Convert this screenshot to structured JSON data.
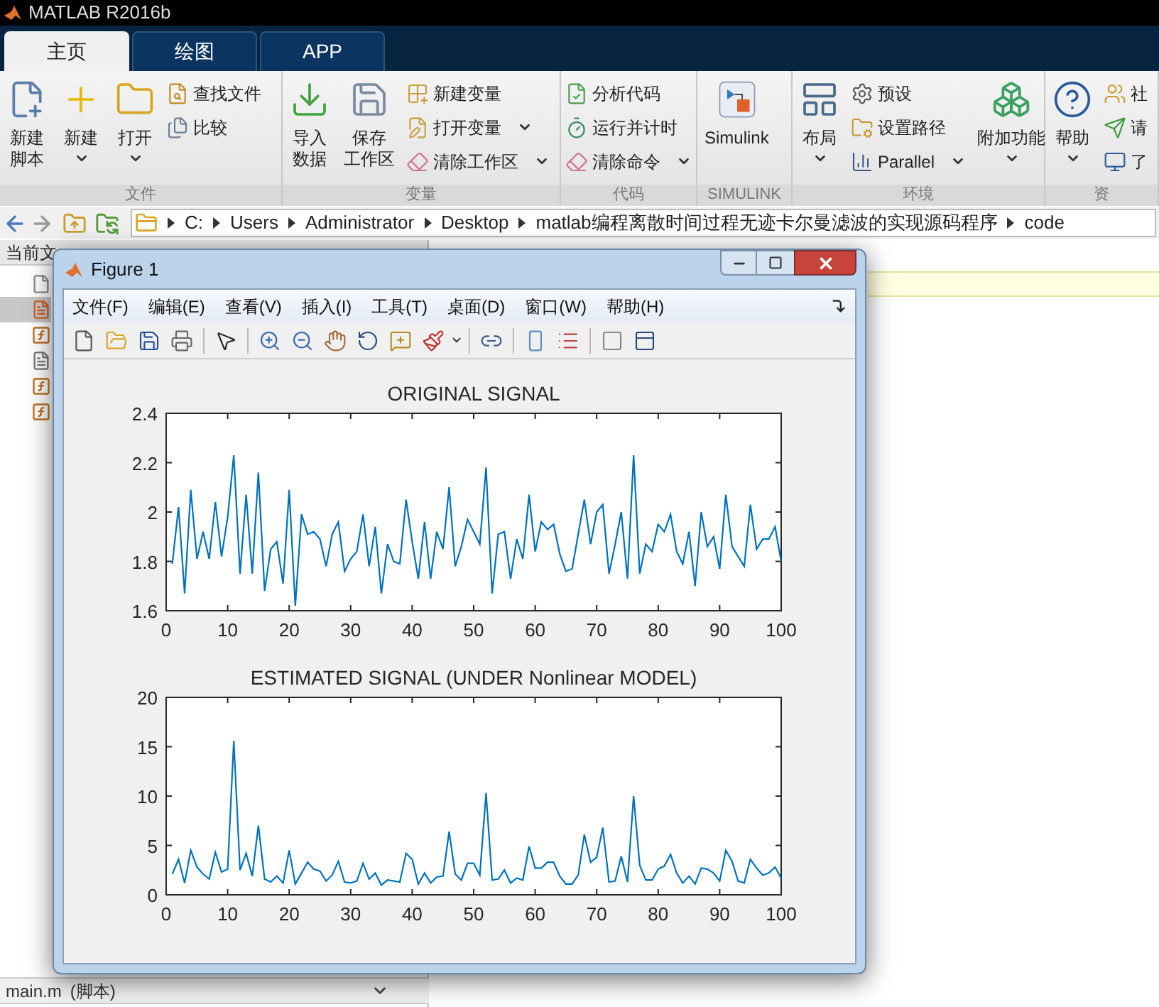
{
  "window": {
    "title": "MATLAB R2016b"
  },
  "tabs": [
    {
      "label": "主页",
      "selected": true
    },
    {
      "label": "绘图",
      "selected": false
    },
    {
      "label": "APP",
      "selected": false
    }
  ],
  "ribbon": {
    "groups": [
      {
        "label": "文件",
        "items": [
          {
            "kind": "large",
            "lines": [
              "新建",
              "脚本"
            ],
            "dropdown": false
          },
          {
            "kind": "large",
            "lines": [
              "新建"
            ],
            "dropdown": true
          },
          {
            "kind": "large",
            "lines": [
              "打开"
            ],
            "dropdown": true
          },
          {
            "kind": "stack",
            "items": [
              {
                "label": "查找文件",
                "dropdown": false
              },
              {
                "label": "比较",
                "dropdown": false
              }
            ]
          }
        ]
      },
      {
        "label": "变量",
        "items": [
          {
            "kind": "large",
            "lines": [
              "导入",
              "数据"
            ],
            "dropdown": false
          },
          {
            "kind": "large",
            "lines": [
              "保存",
              "工作区"
            ],
            "dropdown": false
          },
          {
            "kind": "stack",
            "items": [
              {
                "label": "新建变量",
                "dropdown": false
              },
              {
                "label": "打开变量",
                "dropdown": true
              },
              {
                "label": "清除工作区",
                "dropdown": true
              }
            ]
          }
        ]
      },
      {
        "label": "代码",
        "items": [
          {
            "kind": "stack",
            "items": [
              {
                "label": "分析代码",
                "dropdown": false
              },
              {
                "label": "运行并计时",
                "dropdown": false
              },
              {
                "label": "清除命令",
                "dropdown": true
              }
            ]
          }
        ]
      },
      {
        "label": "SIMULINK",
        "items": [
          {
            "kind": "large",
            "lines": [
              "Simulink"
            ],
            "dropdown": false
          }
        ]
      },
      {
        "label": "环境",
        "items": [
          {
            "kind": "large",
            "lines": [
              "布局"
            ],
            "dropdown": true
          },
          {
            "kind": "stack",
            "items": [
              {
                "label": "预设",
                "dropdown": false
              },
              {
                "label": "设置路径",
                "dropdown": false
              },
              {
                "label": "Parallel",
                "dropdown": true
              }
            ]
          },
          {
            "kind": "large",
            "lines": [
              "附加功能"
            ],
            "dropdown": true
          }
        ]
      },
      {
        "label": "资",
        "items": [
          {
            "kind": "large",
            "lines": [
              "帮助"
            ],
            "dropdown": true
          },
          {
            "kind": "stack",
            "items": [
              {
                "label": "社",
                "dropdown": false
              },
              {
                "label": "请",
                "dropdown": false
              },
              {
                "label": "了",
                "dropdown": false
              }
            ]
          }
        ]
      }
    ]
  },
  "address_bar": {
    "path": [
      "C:",
      "Users",
      "Administrator",
      "Desktop",
      "matlab编程离散时间过程无迹卡尔曼滤波的实现源码程序",
      "code"
    ]
  },
  "current_folder": {
    "title": "当前文",
    "rows": [
      {
        "kind": "blank",
        "selected": false
      },
      {
        "kind": "matlab",
        "selected": true
      },
      {
        "kind": "function",
        "selected": false
      },
      {
        "kind": "doc",
        "selected": false
      },
      {
        "kind": "function",
        "selected": false
      },
      {
        "kind": "function",
        "selected": false
      }
    ]
  },
  "details": {
    "file": "main.m",
    "type": "(脚本)"
  },
  "figure": {
    "title": "Figure 1",
    "menu": [
      "文件(F)",
      "编辑(E)",
      "查看(V)",
      "插入(I)",
      "工具(T)",
      "桌面(D)",
      "窗口(W)",
      "帮助(H)"
    ],
    "plots": [
      {
        "chart_data": {
          "type": "line",
          "title": "ORIGINAL SIGNAL",
          "x": [
            1,
            2,
            3,
            4,
            5,
            6,
            7,
            8,
            9,
            10,
            11,
            12,
            13,
            14,
            15,
            16,
            17,
            18,
            19,
            20,
            21,
            22,
            23,
            24,
            25,
            26,
            27,
            28,
            29,
            30,
            31,
            32,
            33,
            34,
            35,
            36,
            37,
            38,
            39,
            40,
            41,
            42,
            43,
            44,
            45,
            46,
            47,
            48,
            49,
            50,
            51,
            52,
            53,
            54,
            55,
            56,
            57,
            58,
            59,
            60,
            61,
            62,
            63,
            64,
            65,
            66,
            67,
            68,
            69,
            70,
            71,
            72,
            73,
            74,
            75,
            76,
            77,
            78,
            79,
            80,
            81,
            82,
            83,
            84,
            85,
            86,
            87,
            88,
            89,
            90,
            91,
            92,
            93,
            94,
            95,
            96,
            97,
            98,
            99,
            100
          ],
          "xlim": [
            0,
            100
          ],
          "ylim": [
            1.6,
            2.4
          ],
          "xticks": [
            {
              "value": 0,
              "label": "0"
            },
            {
              "value": 10,
              "label": "10"
            },
            {
              "value": 20,
              "label": "20"
            },
            {
              "value": 30,
              "label": "30"
            },
            {
              "value": 40,
              "label": "40"
            },
            {
              "value": 50,
              "label": "50"
            },
            {
              "value": 60,
              "label": "60"
            },
            {
              "value": 70,
              "label": "70"
            },
            {
              "value": 80,
              "label": "80"
            },
            {
              "value": 90,
              "label": "90"
            },
            {
              "value": 100,
              "label": "100"
            }
          ],
          "yticks": [
            {
              "value": 1.6,
              "label": "1.6"
            },
            {
              "value": 1.8,
              "label": "1.8"
            },
            {
              "value": 2,
              "label": "2"
            },
            {
              "value": 2.2,
              "label": "2.2"
            },
            {
              "value": 2.4,
              "label": "2.4"
            }
          ],
          "series": [
            {
              "color": "#0072bd",
              "values": [
                1.79,
                2.02,
                1.67,
                2.09,
                1.81,
                1.92,
                1.81,
                2.04,
                1.82,
                1.98,
                2.23,
                1.75,
                2.07,
                1.75,
                2.16,
                1.68,
                1.85,
                1.88,
                1.71,
                2.09,
                1.62,
                1.99,
                1.91,
                1.92,
                1.89,
                1.78,
                1.91,
                1.96,
                1.76,
                1.81,
                1.84,
                1.99,
                1.78,
                1.94,
                1.67,
                1.87,
                1.8,
                1.79,
                2.05,
                1.88,
                1.73,
                1.96,
                1.73,
                1.92,
                1.85,
                2.1,
                1.78,
                1.86,
                1.97,
                1.92,
                1.87,
                2.18,
                1.67,
                1.91,
                1.92,
                1.73,
                1.89,
                1.81,
                2.07,
                1.84,
                1.96,
                1.93,
                1.95,
                1.83,
                1.76,
                1.77,
                1.91,
                2.05,
                1.87,
                2,
                2.03,
                1.75,
                1.87,
                2,
                1.73,
                2.23,
                1.75,
                1.87,
                1.84,
                1.95,
                1.92,
                1.99,
                1.84,
                1.79,
                1.92,
                1.7,
                2,
                1.86,
                1.9,
                1.77,
                2.07,
                1.86,
                1.82,
                1.78,
                2.03,
                1.85,
                1.89,
                1.89,
                1.94,
                1.8
              ]
            }
          ]
        }
      },
      {
        "chart_data": {
          "type": "line",
          "title": "ESTIMATED SIGNAL (UNDER Nonlinear MODEL)",
          "x": [
            1,
            2,
            3,
            4,
            5,
            6,
            7,
            8,
            9,
            10,
            11,
            12,
            13,
            14,
            15,
            16,
            17,
            18,
            19,
            20,
            21,
            22,
            23,
            24,
            25,
            26,
            27,
            28,
            29,
            30,
            31,
            32,
            33,
            34,
            35,
            36,
            37,
            38,
            39,
            40,
            41,
            42,
            43,
            44,
            45,
            46,
            47,
            48,
            49,
            50,
            51,
            52,
            53,
            54,
            55,
            56,
            57,
            58,
            59,
            60,
            61,
            62,
            63,
            64,
            65,
            66,
            67,
            68,
            69,
            70,
            71,
            72,
            73,
            74,
            75,
            76,
            77,
            78,
            79,
            80,
            81,
            82,
            83,
            84,
            85,
            86,
            87,
            88,
            89,
            90,
            91,
            92,
            93,
            94,
            95,
            96,
            97,
            98,
            99,
            100
          ],
          "xlim": [
            0,
            100
          ],
          "ylim": [
            0,
            20
          ],
          "xticks": [
            {
              "value": 0,
              "label": "0"
            },
            {
              "value": 10,
              "label": "10"
            },
            {
              "value": 20,
              "label": "20"
            },
            {
              "value": 30,
              "label": "30"
            },
            {
              "value": 40,
              "label": "40"
            },
            {
              "value": 50,
              "label": "50"
            },
            {
              "value": 60,
              "label": "60"
            },
            {
              "value": 70,
              "label": "70"
            },
            {
              "value": 80,
              "label": "80"
            },
            {
              "value": 90,
              "label": "90"
            },
            {
              "value": 100,
              "label": "100"
            }
          ],
          "yticks": [
            {
              "value": 0,
              "label": "0"
            },
            {
              "value": 5,
              "label": "5"
            },
            {
              "value": 10,
              "label": "10"
            },
            {
              "value": 15,
              "label": "15"
            },
            {
              "value": 20,
              "label": "20"
            }
          ],
          "series": [
            {
              "color": "#0072bd",
              "values": [
                2.1,
                3.6,
                1.2,
                4.5,
                2.8,
                2.1,
                1.6,
                4.3,
                2.3,
                2.6,
                15.6,
                2.5,
                4.2,
                1.9,
                7,
                1.6,
                1.3,
                1.9,
                1.2,
                4.5,
                1.1,
                2.2,
                3.3,
                2.6,
                2.4,
                1.4,
                2,
                3.4,
                1.3,
                1.2,
                1.4,
                3.2,
                1.6,
                2.2,
                1,
                1.5,
                1.4,
                1.3,
                4.2,
                3.6,
                1.1,
                2.2,
                1.2,
                1.8,
                1.9,
                6.4,
                2.1,
                1.5,
                3.2,
                3.2,
                2,
                10.3,
                1.5,
                1.6,
                2.5,
                1.2,
                1.7,
                1.5,
                4.9,
                2.7,
                2.7,
                3.3,
                3.3,
                1.9,
                1.1,
                1.1,
                2,
                6.1,
                3.3,
                3.8,
                6.8,
                1.3,
                1.4,
                3.9,
                1.3,
                10,
                3,
                1.5,
                1.5,
                2.6,
                2.9,
                4.1,
                2.2,
                1.2,
                1.9,
                1.1,
                2.7,
                2.6,
                2.2,
                1.4,
                4.5,
                3.4,
                1.4,
                1.2,
                3.6,
                2.7,
                2,
                2.2,
                2.8,
                1.7
              ]
            }
          ]
        }
      }
    ]
  }
}
